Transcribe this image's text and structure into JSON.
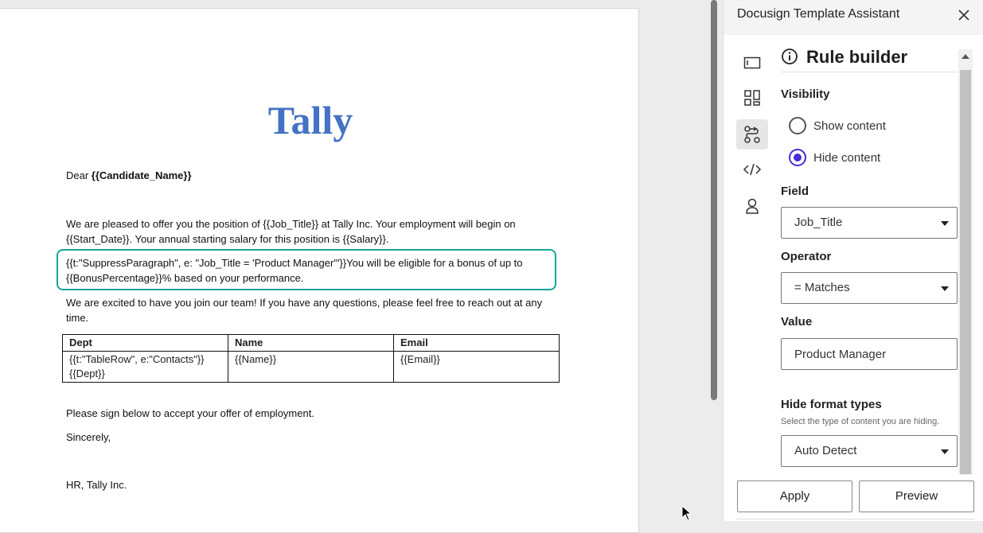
{
  "document": {
    "title": "Tally",
    "salutation_prefix": "Dear ",
    "salutation_field": "{{Candidate_Name}}",
    "para1_line1": "We are pleased to offer you the position of {{Job_Title}} at Tally Inc. Your employment will begin on",
    "para1_line2": "{{Start_Date}}. Your annual starting salary for this position is {{Salary}}.",
    "para2_line1": "{{t:\"SuppressParagraph\", e: \"Job_Title = 'Product Manager'\"}}You will be eligible for a bonus of up to",
    "para2_line2": "{{BonusPercentage}}% based on your performance.",
    "para3_line1": "We are excited to have you join our team! If you have any questions, please feel free to reach out at any",
    "para3_line2": "time.",
    "table": {
      "headers": [
        "Dept",
        "Name",
        "Email"
      ],
      "row": [
        "{{t:\"TableRow\", e:\"Contacts\"}}",
        "{{Name}}",
        "{{Email}}"
      ],
      "row_line2": "{{Dept}}"
    },
    "para4": "Please sign below to accept your offer of employment.",
    "closing": "Sincerely,",
    "signature": "HR, Tally Inc."
  },
  "panel": {
    "title": "Docusign Template Assistant",
    "rail_icons": [
      "panel-icon",
      "layout-icon",
      "rules-icon",
      "code-icon",
      "person-icon"
    ],
    "rule_builder": {
      "title": "Rule builder",
      "visibility_label": "Visibility",
      "options": [
        "Show content",
        "Hide content"
      ],
      "selected": "Hide content",
      "field_label": "Field",
      "field_value": "Job_Title",
      "operator_label": "Operator",
      "operator_value": "= Matches",
      "value_label": "Value",
      "value_value": "Product Manager",
      "hide_format_label": "Hide format types",
      "hide_format_hint": "Select the type of content you are hiding.",
      "hide_format_value": "Auto Detect"
    },
    "apply_label": "Apply",
    "preview_label": "Preview"
  },
  "colors": {
    "accent": "#4b2bd6",
    "highlight": "#1aa39a",
    "title_blue": "#4472c4"
  }
}
